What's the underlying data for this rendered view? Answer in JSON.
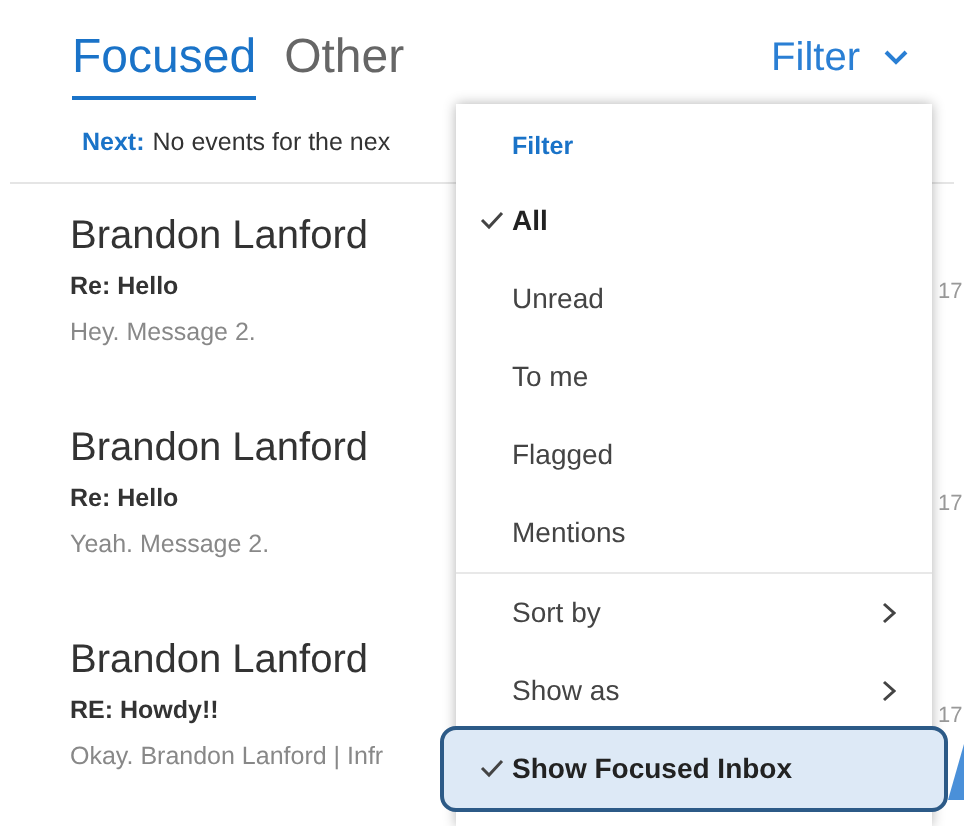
{
  "tabs": [
    {
      "label": "Focused",
      "selected": true
    },
    {
      "label": "Other",
      "selected": false
    }
  ],
  "filter_button": {
    "label": "Filter"
  },
  "next_banner": {
    "label": "Next:",
    "text": "No events for the nex"
  },
  "messages": [
    {
      "sender": "Brandon Lanford",
      "subject": "Re: Hello",
      "preview": "Hey. Message 2.",
      "date": "17"
    },
    {
      "sender": "Brandon Lanford",
      "subject": "Re: Hello",
      "preview": "Yeah. Message 2.",
      "date": "17"
    },
    {
      "sender": "Brandon Lanford",
      "subject": "RE: Howdy!!",
      "preview": "Okay. Brandon Lanford | Infr",
      "date": "17"
    }
  ],
  "filter_menu": {
    "heading": "Filter",
    "groups": [
      [
        {
          "label": "All",
          "kind": "option",
          "checked": true,
          "selected": false
        },
        {
          "label": "Unread",
          "kind": "option",
          "checked": false,
          "selected": false
        },
        {
          "label": "To me",
          "kind": "option",
          "checked": false,
          "selected": false
        },
        {
          "label": "Flagged",
          "kind": "option",
          "checked": false,
          "selected": false
        },
        {
          "label": "Mentions",
          "kind": "option",
          "checked": false,
          "selected": false
        }
      ],
      [
        {
          "label": "Sort by",
          "kind": "submenu",
          "checked": false,
          "selected": false
        },
        {
          "label": "Show as",
          "kind": "submenu",
          "checked": false,
          "selected": false
        },
        {
          "label": "Show Focused Inbox",
          "kind": "option",
          "checked": true,
          "selected": true
        }
      ]
    ]
  }
}
